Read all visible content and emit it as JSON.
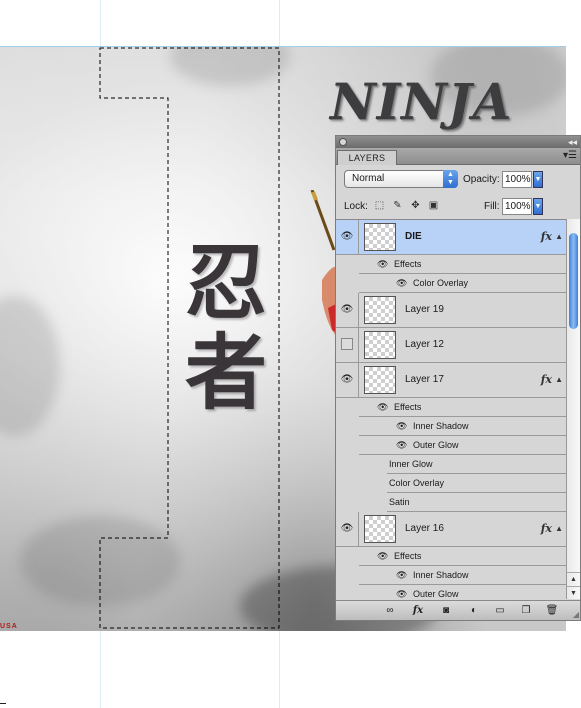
{
  "canvas": {
    "logo_text": "NINJA",
    "kanji_line1": "忍",
    "kanji_line2": "者",
    "usa_text": "USA"
  },
  "panel": {
    "tab_label": "LAYERS",
    "close_icon": "close-dot-icon",
    "collapse_icon": "collapse-arrows-icon",
    "menu_icon": "panel-menu-icon",
    "blend_mode": "Normal",
    "opacity_label": "Opacity:",
    "opacity_value": "100%",
    "lock_label": "Lock:",
    "fill_label": "Fill:",
    "fill_value": "100%",
    "lock_icons": [
      "lock-transparency-icon",
      "lock-paint-icon",
      "lock-position-icon",
      "lock-all-icon"
    ]
  },
  "layers": [
    {
      "name": "DIE",
      "selected": true,
      "visible": true,
      "fx": true,
      "effects_label": "Effects",
      "effects": [
        "Color Overlay"
      ]
    },
    {
      "name": "Layer 19",
      "visible": true
    },
    {
      "name": "Layer 12",
      "visible": false
    },
    {
      "name": "Layer 17",
      "visible": true,
      "fx": true,
      "effects_label": "Effects",
      "effects_on": [
        "Inner Shadow",
        "Outer Glow"
      ],
      "effects_off": [
        "Inner Glow",
        "Color Overlay",
        "Satin"
      ]
    },
    {
      "name": "Layer 16",
      "visible": true,
      "fx": true,
      "effects_label": "Effects",
      "effects_on": [
        "Inner Shadow",
        "Outer Glow"
      ]
    }
  ],
  "fx_label": "fx",
  "footer": {
    "icons": [
      "link-layers-icon",
      "add-style-icon",
      "add-mask-icon",
      "adjustment-layer-icon",
      "new-group-icon",
      "new-layer-icon",
      "delete-layer-icon"
    ]
  },
  "colors": {
    "selected_row": "#b7d2f6",
    "accent_blue": "#2f6fd1",
    "usa_red": "#b01a1a"
  }
}
